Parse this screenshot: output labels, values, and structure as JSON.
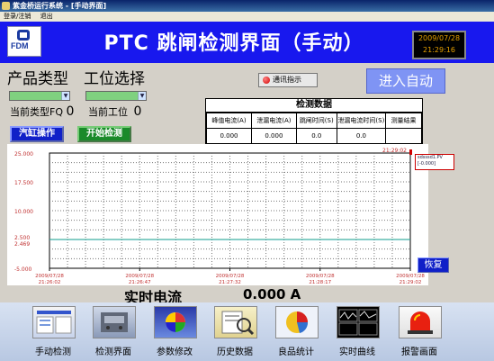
{
  "window": {
    "title": "紫金桥运行系统 - [手动界面]"
  },
  "menu": {
    "items": [
      "登录/注销",
      "退出"
    ]
  },
  "header": {
    "logo_text": "FDM",
    "title": "PTC 跳闸检测界面（手动）",
    "clock_date": "2009/07/28",
    "clock_time": "21:29:16"
  },
  "controls": {
    "product_type_label": "产品类型",
    "station_label": "工位选择",
    "current_type_label": "当前类型FQ",
    "current_type_value": "0",
    "current_station_label": "当前工位",
    "current_station_value": "0",
    "cylinder_button": "汽缸操作",
    "start_button": "开始检测",
    "comm_indicator": "通讯指示",
    "auto_button": "进入自动"
  },
  "data_table": {
    "caption": "检测数据",
    "headers": [
      "峰值电流(A)",
      "泄漏电流(A)",
      "跳闸时间(S)",
      "泄漏电流时间(S)",
      "测量结果"
    ],
    "row": [
      "0.000",
      "0.000",
      "0.0",
      "0.0",
      ""
    ]
  },
  "chart_data": {
    "type": "line",
    "y_ticks": [
      "25.000",
      "17.500",
      "10.000",
      "2.500",
      "2.469",
      "-5.000"
    ],
    "ylim": [
      -5.0,
      25.0
    ],
    "x_ticks": [
      {
        "date": "2009/07/28",
        "time": "21:26:02"
      },
      {
        "date": "2009/07/28",
        "time": "21:26:47"
      },
      {
        "date": "2009/07/28",
        "time": "21:27:32"
      },
      {
        "date": "2009/07/28",
        "time": "21:28:17"
      },
      {
        "date": "2009/07/28",
        "time": "21:29:02"
      }
    ],
    "top_right_time": "21:29:02",
    "series": [
      {
        "name": "sdsssd1.PV",
        "current_value": "-0.000"
      }
    ],
    "reference_lines": [
      2.5,
      2.469
    ],
    "grid": true
  },
  "restore_button": "恢复",
  "realtime": {
    "label": "实时电流",
    "value": "0.000 A"
  },
  "nav": {
    "items": [
      {
        "label": "手动检测",
        "icon": "manual-test-icon"
      },
      {
        "label": "检测界面",
        "icon": "test-screen-icon"
      },
      {
        "label": "参数修改",
        "icon": "param-edit-icon"
      },
      {
        "label": "历史数据",
        "icon": "history-data-icon"
      },
      {
        "label": "良品统计",
        "icon": "statistics-icon"
      },
      {
        "label": "实时曲线",
        "icon": "realtime-curve-icon"
      },
      {
        "label": "报警画面",
        "icon": "alarm-icon"
      }
    ]
  },
  "colors": {
    "header_bg": "#1818ee",
    "accent_blue": "#1020c8",
    "accent_green": "#1a8a2a",
    "clock_text": "#e6a000"
  }
}
